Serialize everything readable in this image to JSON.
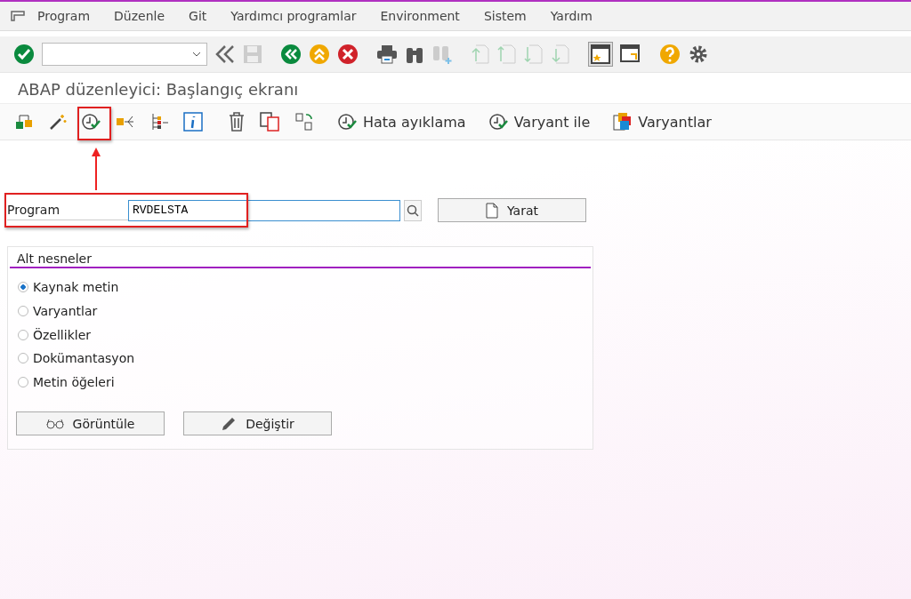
{
  "menu": [
    "Program",
    "Düzenle",
    "Git",
    "Yardımcı programlar",
    "Environment",
    "Sistem",
    "Yardım"
  ],
  "title": "ABAP düzenleyici: Başlangıç ekranı",
  "app_toolbar": {
    "text_buttons": [
      "Hata ayıklama",
      "Varyant ile",
      "Varyantlar"
    ]
  },
  "program_field": {
    "label": "Program",
    "value": "RVDELSTA"
  },
  "create_button": "Yarat",
  "subobjects": {
    "title": "Alt nesneler",
    "options": [
      {
        "label": "Kaynak metin",
        "selected": true
      },
      {
        "label": "Varyantlar",
        "selected": false
      },
      {
        "label": "Özellikler",
        "selected": false
      },
      {
        "label": "Dokümantasyon",
        "selected": false
      },
      {
        "label": "Metin öğeleri",
        "selected": false
      }
    ]
  },
  "buttons": [
    "Görüntüle",
    "Değiştir"
  ]
}
